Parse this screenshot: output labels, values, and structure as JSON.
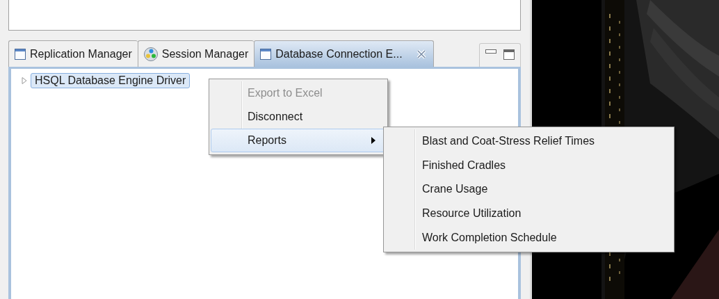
{
  "tabs": [
    {
      "label": "Replication Manager",
      "kind": "window",
      "selected": false
    },
    {
      "label": "Session Manager",
      "kind": "session",
      "selected": false
    },
    {
      "label": "Database Connection E...",
      "kind": "window",
      "selected": true
    }
  ],
  "tree": [
    {
      "label": "HSQL Database Engine Driver",
      "expanded": false,
      "selected": true
    }
  ],
  "context_menu": [
    {
      "label": "Export to Excel",
      "disabled": true,
      "selected": false,
      "submenu": false
    },
    {
      "label": "Disconnect",
      "disabled": false,
      "selected": false,
      "submenu": false
    },
    {
      "label": "Reports",
      "disabled": false,
      "selected": true,
      "submenu": true
    }
  ],
  "submenu": [
    {
      "label": "Blast and Coat-Stress Relief Times",
      "selected": false
    },
    {
      "label": "Finished Cradles",
      "selected": false
    },
    {
      "label": "Crane Usage",
      "selected": false
    },
    {
      "label": "Resource Utilization",
      "selected": false
    },
    {
      "label": "Work Completion Schedule",
      "selected": false
    }
  ]
}
